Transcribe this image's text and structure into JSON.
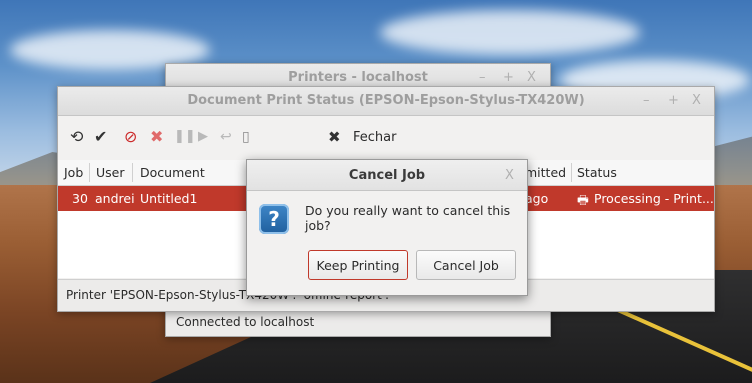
{
  "printers_window": {
    "title": "Printers - localhost",
    "controls": [
      "–",
      "+",
      "X"
    ],
    "status": "Connected to localhost"
  },
  "status_window": {
    "title": "Document Print Status (EPSON-Epson-Stylus-TX420W)",
    "controls": [
      "–",
      "+",
      "X"
    ],
    "toolbar": {
      "icons": [
        "refresh-icon",
        "check-icon",
        "cancel-circle-icon",
        "delete-x-icon",
        "pause-icon",
        "play-icon",
        "reprint-icon",
        "move-job-icon"
      ],
      "close_label": "Fechar"
    },
    "columns": [
      "Job",
      "User",
      "Document",
      "mitted",
      "Status"
    ],
    "rows": [
      {
        "job": "30",
        "user": "andrei",
        "document": "Untitled1",
        "submitted": "ago",
        "status": "Processing - Print..."
      }
    ],
    "status_bar": "Printer 'EPSON-Epson-Stylus-TX420W': 'offline-report'."
  },
  "cancel_dialog": {
    "title": "Cancel Job",
    "close": "X",
    "message": "Do you really want to cancel this job?",
    "keep_button": "Keep Printing",
    "cancel_button": "Cancel Job"
  },
  "colors": {
    "selection": "#c0392b",
    "focus_border": "#c0392b"
  }
}
